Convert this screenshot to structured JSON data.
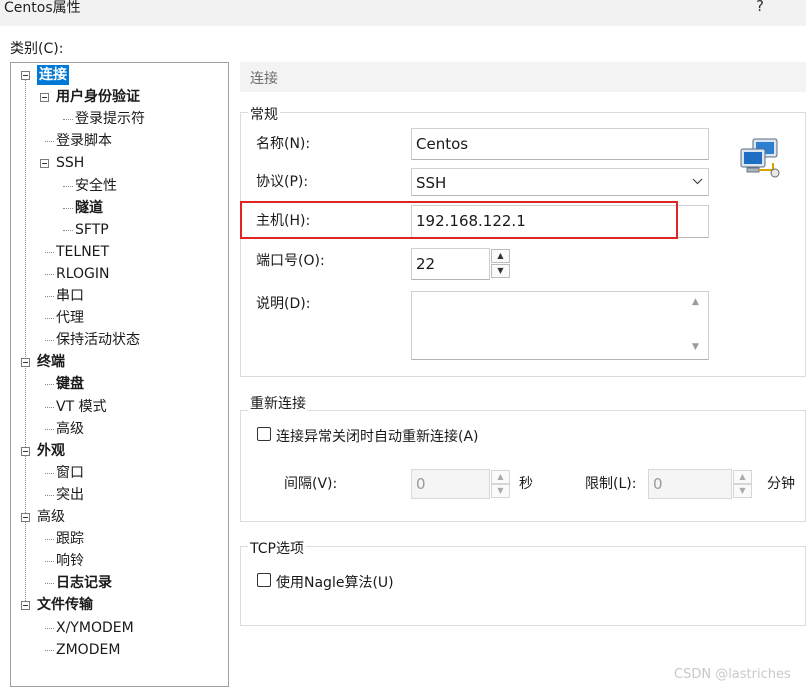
{
  "window": {
    "title": "Centos属性",
    "help": "?"
  },
  "category_label": "类别(C):",
  "tree": [
    {
      "label": "连接",
      "bold": true,
      "selected": true,
      "expander": true
    },
    {
      "label": "用户身份验证",
      "bold": true,
      "expander": true
    },
    {
      "label": "登录提示符"
    },
    {
      "label": "登录脚本"
    },
    {
      "label": "SSH",
      "expander": true
    },
    {
      "label": "安全性"
    },
    {
      "label": "隧道",
      "bold": true
    },
    {
      "label": "SFTP"
    },
    {
      "label": "TELNET"
    },
    {
      "label": "RLOGIN"
    },
    {
      "label": "串口"
    },
    {
      "label": "代理"
    },
    {
      "label": "保持活动状态"
    },
    {
      "label": "终端",
      "bold": true,
      "expander": true
    },
    {
      "label": "键盘",
      "bold": true
    },
    {
      "label": "VT 模式"
    },
    {
      "label": "高级"
    },
    {
      "label": "外观",
      "bold": true,
      "expander": true
    },
    {
      "label": "窗口"
    },
    {
      "label": "突出"
    },
    {
      "label": "高级",
      "expander": true
    },
    {
      "label": "跟踪"
    },
    {
      "label": "响铃"
    },
    {
      "label": "日志记录",
      "bold": true
    },
    {
      "label": "文件传输",
      "bold": true,
      "expander": true
    },
    {
      "label": "X/YMODEM"
    },
    {
      "label": "ZMODEM"
    }
  ],
  "section_header": "连接",
  "general": {
    "title": "常规",
    "name_label": "名称(N):",
    "name_value": "Centos",
    "protocol_label": "协议(P):",
    "protocol_value": "SSH",
    "host_label": "主机(H):",
    "host_value": "192.168.122.1",
    "port_label": "端口号(O):",
    "port_value": "22",
    "desc_label": "说明(D):",
    "desc_value": ""
  },
  "reconnect": {
    "title": "重新连接",
    "checkbox_label": "连接异常关闭时自动重新连接(A)",
    "checked": false,
    "interval_label": "间隔(V):",
    "interval_value": "0",
    "interval_unit": "秒",
    "limit_label": "限制(L):",
    "limit_value": "0",
    "limit_unit": "分钟"
  },
  "tcp": {
    "title": "TCP选项",
    "nagle_label": "使用Nagle算法(U)",
    "checked": false
  },
  "icons": {
    "session": "network-computers-icon",
    "dropdown": "chevron-down-icon"
  },
  "colors": {
    "selection": "#0078d7",
    "highlight_box": "#e02424"
  },
  "watermark": "CSDN @lastriches"
}
